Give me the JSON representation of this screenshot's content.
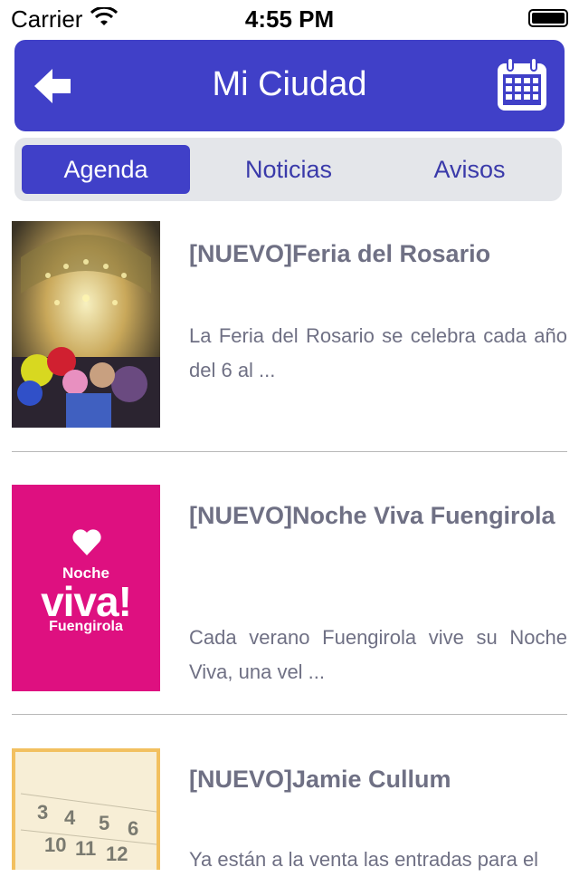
{
  "status_bar": {
    "carrier": "Carrier",
    "time": "4:55 PM"
  },
  "header": {
    "title": "Mi Ciudad",
    "back_icon": "arrow-left-icon",
    "calendar_icon": "calendar-icon",
    "color": "#4040c8"
  },
  "tabs": [
    {
      "label": "Agenda",
      "active": true
    },
    {
      "label": "Noticias",
      "active": false
    },
    {
      "label": "Avisos",
      "active": false
    }
  ],
  "items": [
    {
      "title": "[NUEVO]Feria del Rosario",
      "description": "La Feria del Rosario se celebra cada año del 6 al ..."
    },
    {
      "title": "[NUEVO]Noche Viva Fuengirola",
      "description": "Cada verano Fuengirola vive su Noche Viva, una vel ...",
      "image_text": {
        "line1": "Noche",
        "line2": "viva!",
        "line3": "Fuengirola"
      }
    },
    {
      "title": "[NUEVO]Jamie Cullum",
      "description": "Ya están a la venta las entradas para el"
    }
  ]
}
